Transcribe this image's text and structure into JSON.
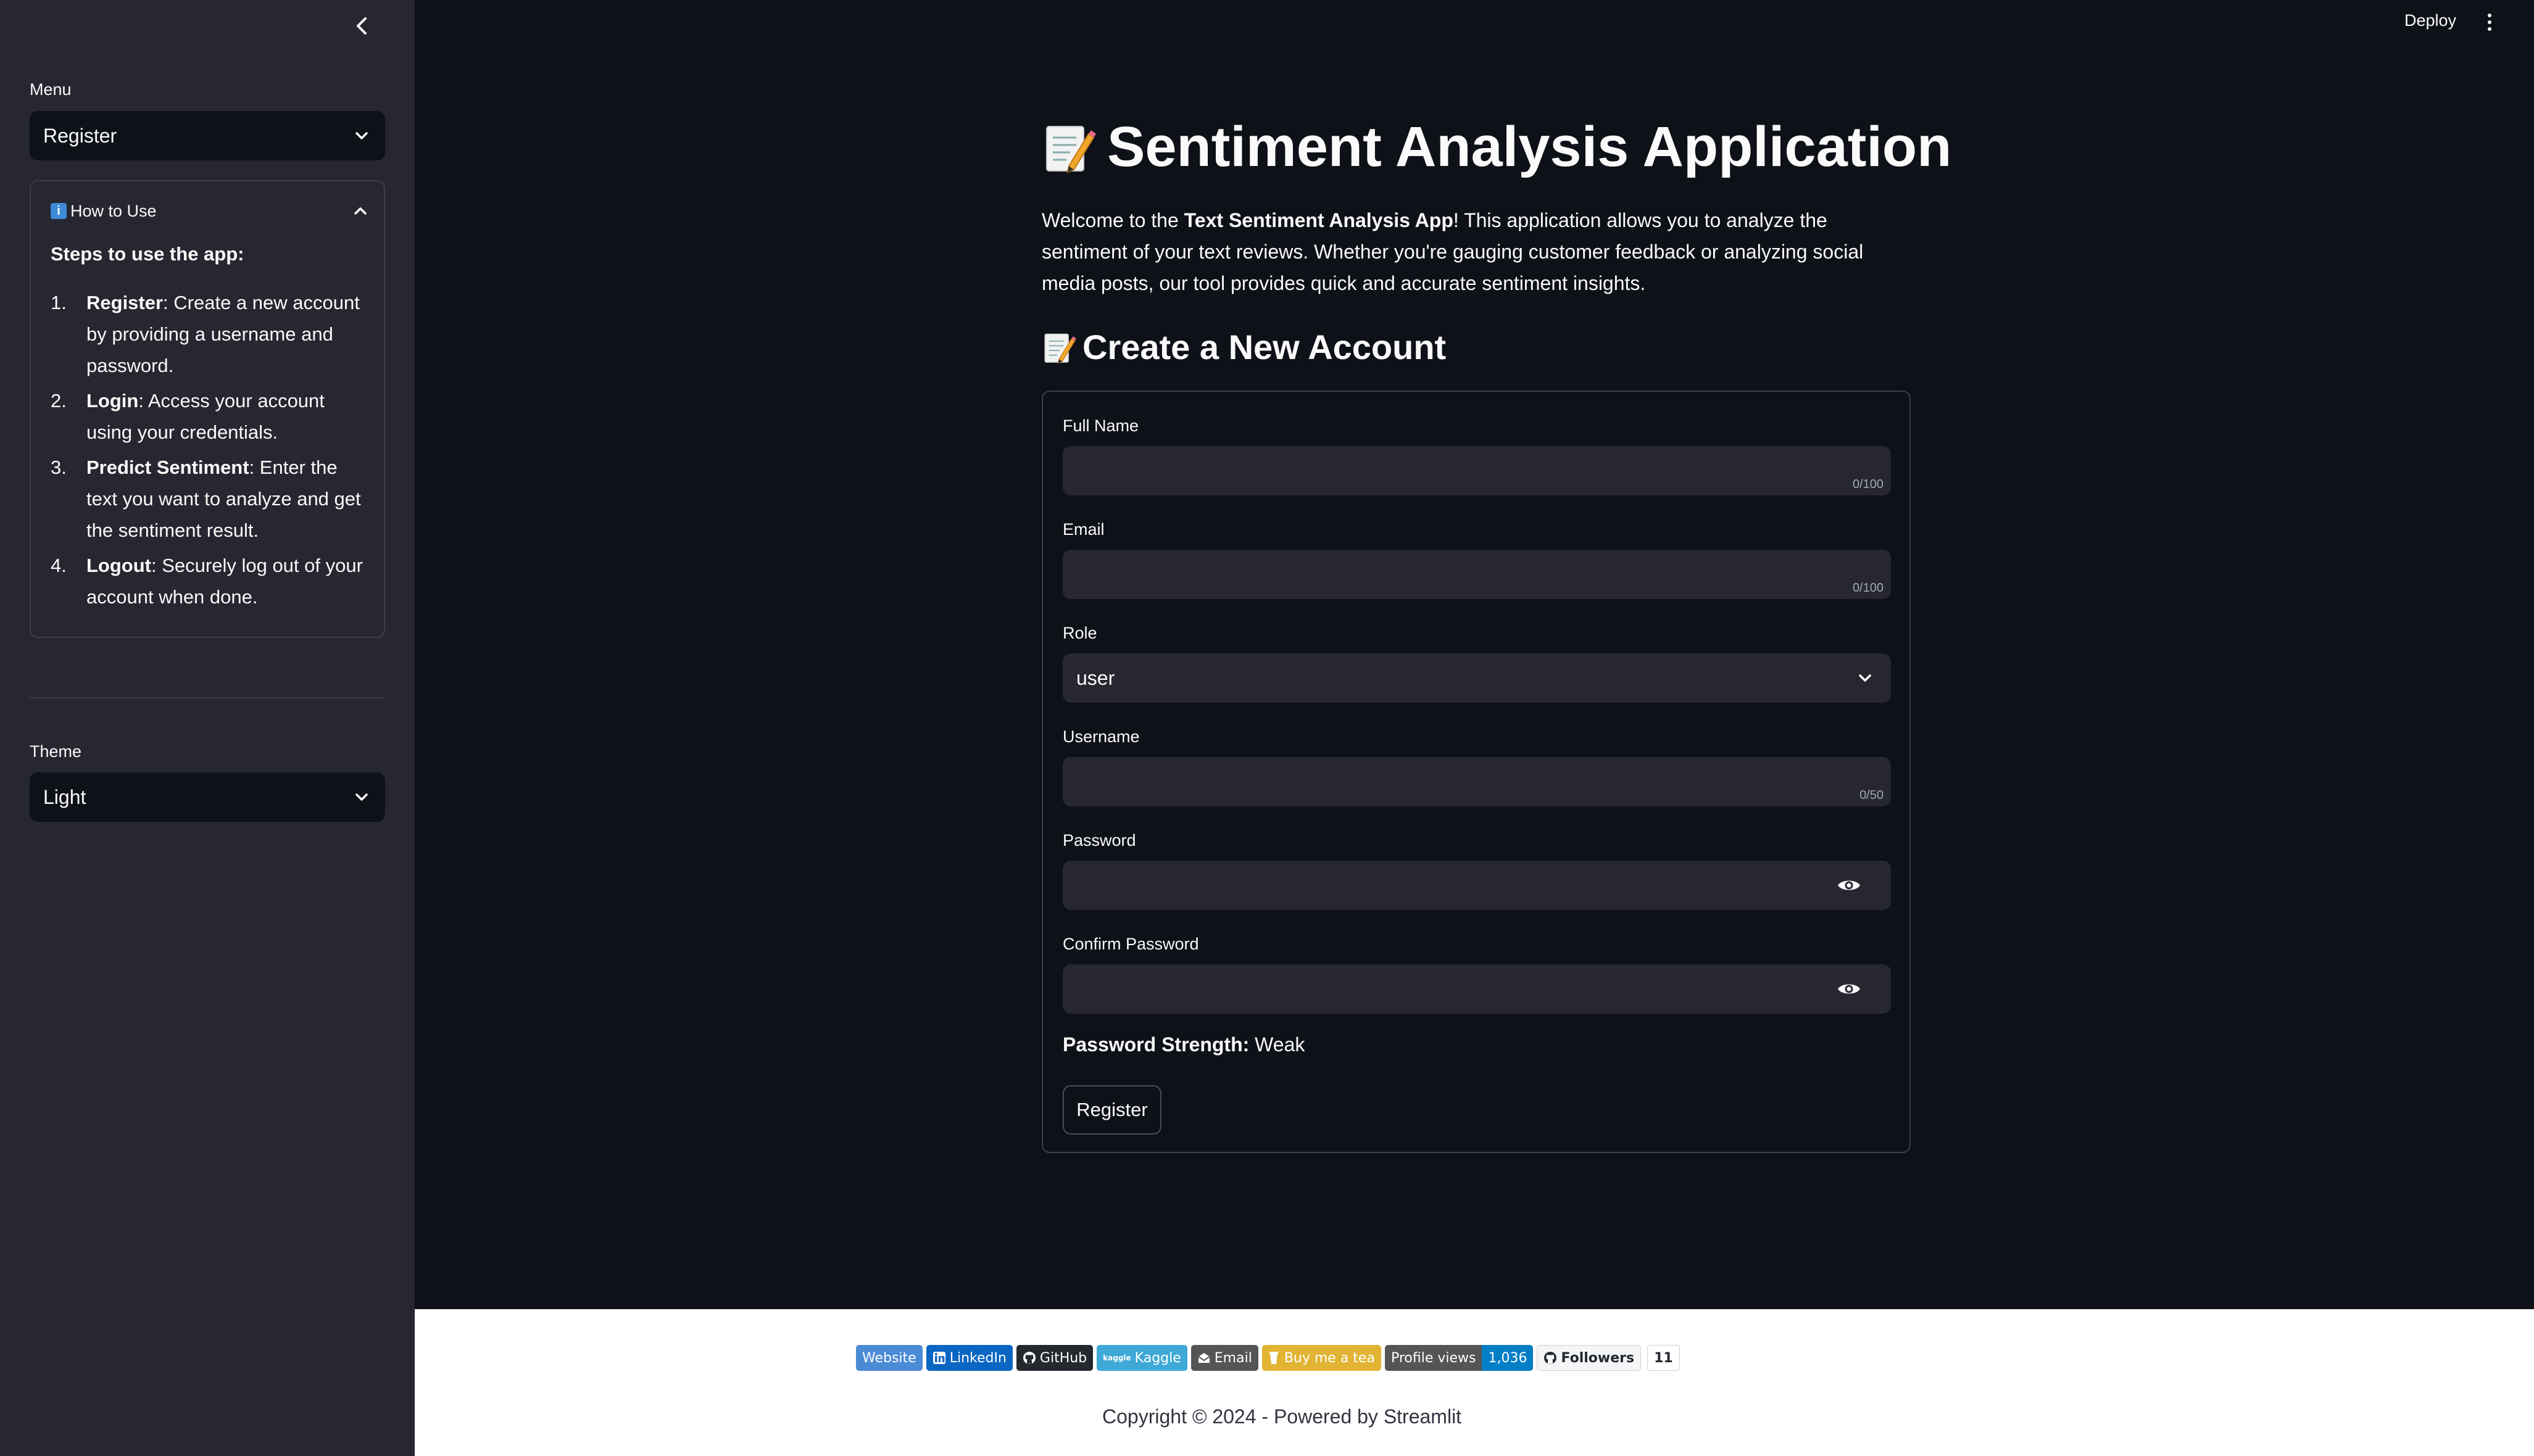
{
  "sidebar": {
    "menu_label": "Menu",
    "menu_value": "Register",
    "how_to": {
      "title": "How to Use",
      "steps_title": "Steps to use the app:",
      "steps": [
        {
          "num": "1.",
          "bold": "Register",
          "text": ": Create a new account by providing a username and password."
        },
        {
          "num": "2.",
          "bold": "Login",
          "text": ": Access your account using your credentials."
        },
        {
          "num": "3.",
          "bold": "Predict Sentiment",
          "text": ": Enter the text you want to analyze and get the sentiment result."
        },
        {
          "num": "4.",
          "bold": "Logout",
          "text": ": Securely log out of your account when done."
        }
      ]
    },
    "theme_label": "Theme",
    "theme_value": "Light"
  },
  "header": {
    "deploy_label": "Deploy"
  },
  "main": {
    "title": "Sentiment Analysis Application",
    "intro_prefix": "Welcome to the ",
    "intro_bold": "Text Sentiment Analysis App",
    "intro_suffix": "! This application allows you to analyze the sentiment of your text reviews. Whether you're gauging customer feedback or analyzing social media posts, our tool provides quick and accurate sentiment insights.",
    "form_title": "Create a New Account",
    "form": {
      "full_name_label": "Full Name",
      "full_name_value": "",
      "full_name_counter": "0/100",
      "email_label": "Email",
      "email_value": "",
      "email_counter": "0/100",
      "role_label": "Role",
      "role_value": "user",
      "username_label": "Username",
      "username_value": "",
      "username_counter": "0/50",
      "password_label": "Password",
      "confirm_password_label": "Confirm Password",
      "strength_label": "Password Strength:",
      "strength_value": "Weak",
      "register_label": "Register"
    }
  },
  "footer": {
    "badges": [
      {
        "name": "website",
        "left": "Website",
        "left_color": "#4b8bd6"
      },
      {
        "name": "linkedin",
        "left": "LinkedIn",
        "left_color": "#0a66c2",
        "icon": "linkedin-icon"
      },
      {
        "name": "github",
        "left": "GitHub",
        "left_color": "#24292f",
        "icon": "github-icon"
      },
      {
        "name": "kaggle",
        "left": "Kaggle",
        "left_color": "#3ea9d6",
        "icon": "kaggle-icon"
      },
      {
        "name": "email",
        "left": "Email",
        "left_color": "#555555",
        "icon": "email-icon"
      },
      {
        "name": "buy-me-a-tea",
        "left": "Buy me a tea",
        "left_color": "#e1b434",
        "icon": "tea-icon"
      }
    ],
    "profile_views_label": "Profile views",
    "profile_views_value": "1,036",
    "followers_label": "Followers",
    "followers_count": "11",
    "copyright": "Copyright © 2024 - Powered by Streamlit"
  },
  "colors": {
    "app_bg": "#0e1117",
    "sidebar_bg": "#262730",
    "input_bg": "#262730",
    "text": "#fafafa",
    "footer_bg": "#ffffff"
  }
}
